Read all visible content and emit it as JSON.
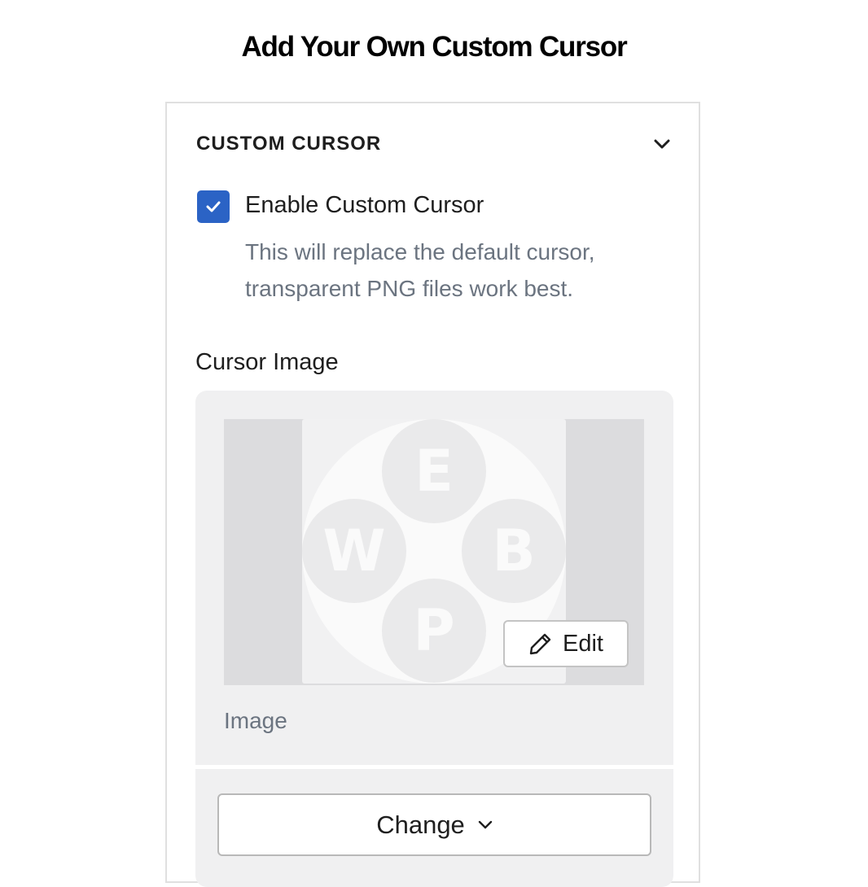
{
  "page": {
    "title": "Add Your Own Custom Cursor"
  },
  "panel": {
    "title": "CUSTOM CURSOR",
    "toggle_icon": "chevron-down-icon",
    "enable_checkbox": {
      "checked": true,
      "label": "Enable Custom Cursor",
      "help": "This will replace the default cursor, transparent PNG files work best."
    },
    "cursor_image": {
      "label": "Cursor Image",
      "preview_letters": {
        "top": "E",
        "left": "W",
        "right": "B",
        "bottom": "P"
      },
      "edit_button": {
        "label": "Edit",
        "icon": "pencil-icon"
      },
      "caption": "Image",
      "change_button": {
        "label": "Change",
        "icon": "chevron-down-icon"
      }
    }
  },
  "colors": {
    "accent": "#2b63c5",
    "text": "#1e1e1e",
    "muted_text": "#6b7480",
    "card_bg": "#f0f0f1"
  }
}
